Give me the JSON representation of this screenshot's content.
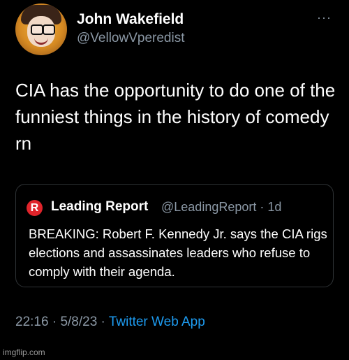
{
  "tweet": {
    "author_name": "John Wakefield",
    "author_handle": "@VellowVperedist",
    "more_icon": "more-icon",
    "more_glyph": "···",
    "text": "CIA has the opportunity to do one of the funniest things in the history of comedy rn",
    "quoted": {
      "logo_letter": "R",
      "logo_color": "#e0242b",
      "author_name": "Leading Report",
      "author_handle": "@LeadingReport · 1d",
      "text": "BREAKING: Robert F. Kennedy Jr. says the CIA rigs elections and assassinates leaders who refuse to comply with their agenda."
    },
    "time": "22:16",
    "sep1": " · ",
    "date": "5/8/23",
    "sep2": " · ",
    "source": "Twitter Web App"
  },
  "colors": {
    "background": "#000000",
    "text": "#ffffff",
    "secondary": "#8b98a5",
    "link": "#1d9bf0",
    "border": "#2f3336"
  },
  "watermark": "imgflip.com"
}
